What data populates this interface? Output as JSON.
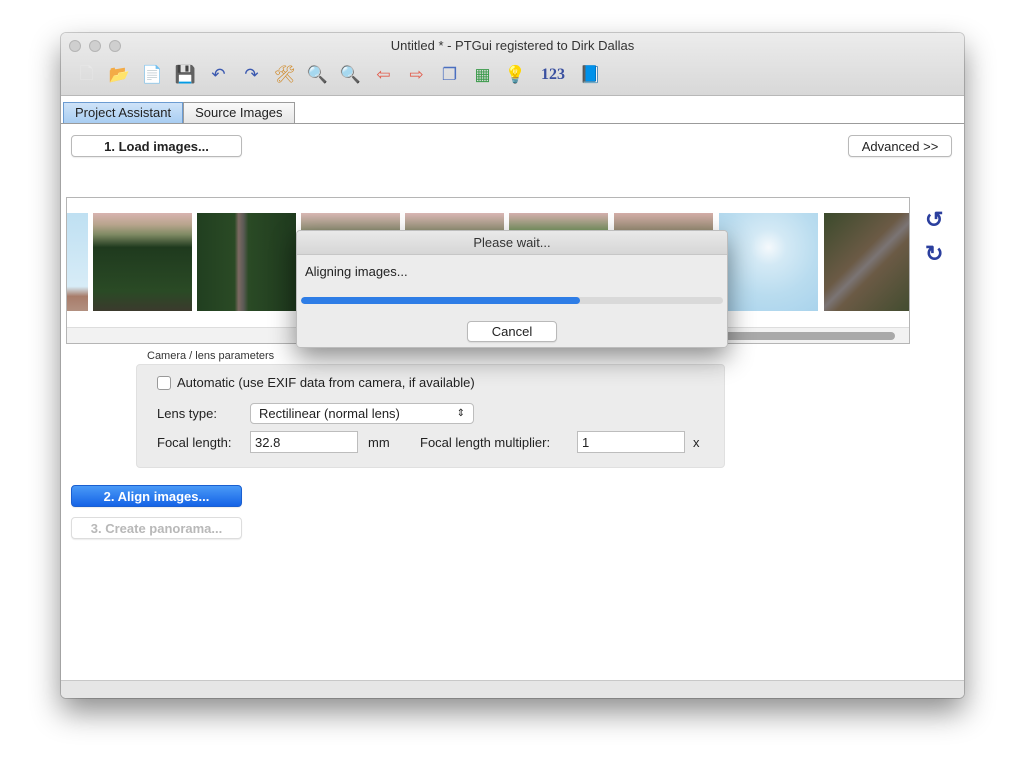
{
  "window": {
    "title": "Untitled * - PTGui registered to Dirk Dallas"
  },
  "toolbar": {
    "items": [
      {
        "icon": "new-document-icon",
        "glyph": "🗋"
      },
      {
        "icon": "open-project-icon",
        "glyph": "📂"
      },
      {
        "icon": "add-images-icon",
        "glyph": "📄"
      },
      {
        "icon": "save-icon",
        "glyph": "💾"
      },
      {
        "icon": "undo-icon",
        "glyph": "↶"
      },
      {
        "icon": "redo-icon",
        "glyph": "↷"
      },
      {
        "icon": "tools-icon",
        "glyph": "🛠"
      },
      {
        "icon": "zoom-in-icon",
        "glyph": "🔍"
      },
      {
        "icon": "zoom-out-icon",
        "glyph": "🔍"
      },
      {
        "icon": "arrow-left-icon",
        "glyph": "⇦"
      },
      {
        "icon": "arrow-right-icon",
        "glyph": "⇨"
      },
      {
        "icon": "panorama-editor-icon",
        "glyph": "❐"
      },
      {
        "icon": "table-icon",
        "glyph": "▦"
      },
      {
        "icon": "lightbulb-icon",
        "glyph": "💡"
      },
      {
        "icon": "numbers-icon",
        "glyph": "123"
      },
      {
        "icon": "help-book-icon",
        "glyph": "📘"
      }
    ]
  },
  "tabs": [
    {
      "label": "Project Assistant",
      "active": true
    },
    {
      "label": "Source Images",
      "active": false
    }
  ],
  "buttons": {
    "load_images": "1. Load images...",
    "advanced": "Advanced >>",
    "align_images": "2. Align images...",
    "create_panorama": "3. Create panorama..."
  },
  "thumbnails": {
    "count_visible": 9,
    "rotate_left_icon": "rotate-ccw-icon",
    "rotate_right_icon": "rotate-cw-icon"
  },
  "camera": {
    "group_label": "Camera / lens parameters",
    "automatic_label": "Automatic (use EXIF data from camera, if available)",
    "automatic_checked": false,
    "lens_type_label": "Lens type:",
    "lens_type_value": "Rectilinear (normal lens)",
    "focal_length_label": "Focal length:",
    "focal_length_value": "32.8",
    "focal_length_unit": "mm",
    "multiplier_label": "Focal length multiplier:",
    "multiplier_value": "1",
    "multiplier_unit": "x"
  },
  "dialog": {
    "title": "Please wait...",
    "message": "Aligning images...",
    "progress_percent": 66,
    "cancel_label": "Cancel"
  },
  "colors": {
    "accent": "#1563e6",
    "progress": "#2e7de6",
    "rotate_icons": "#2b3f9e"
  }
}
